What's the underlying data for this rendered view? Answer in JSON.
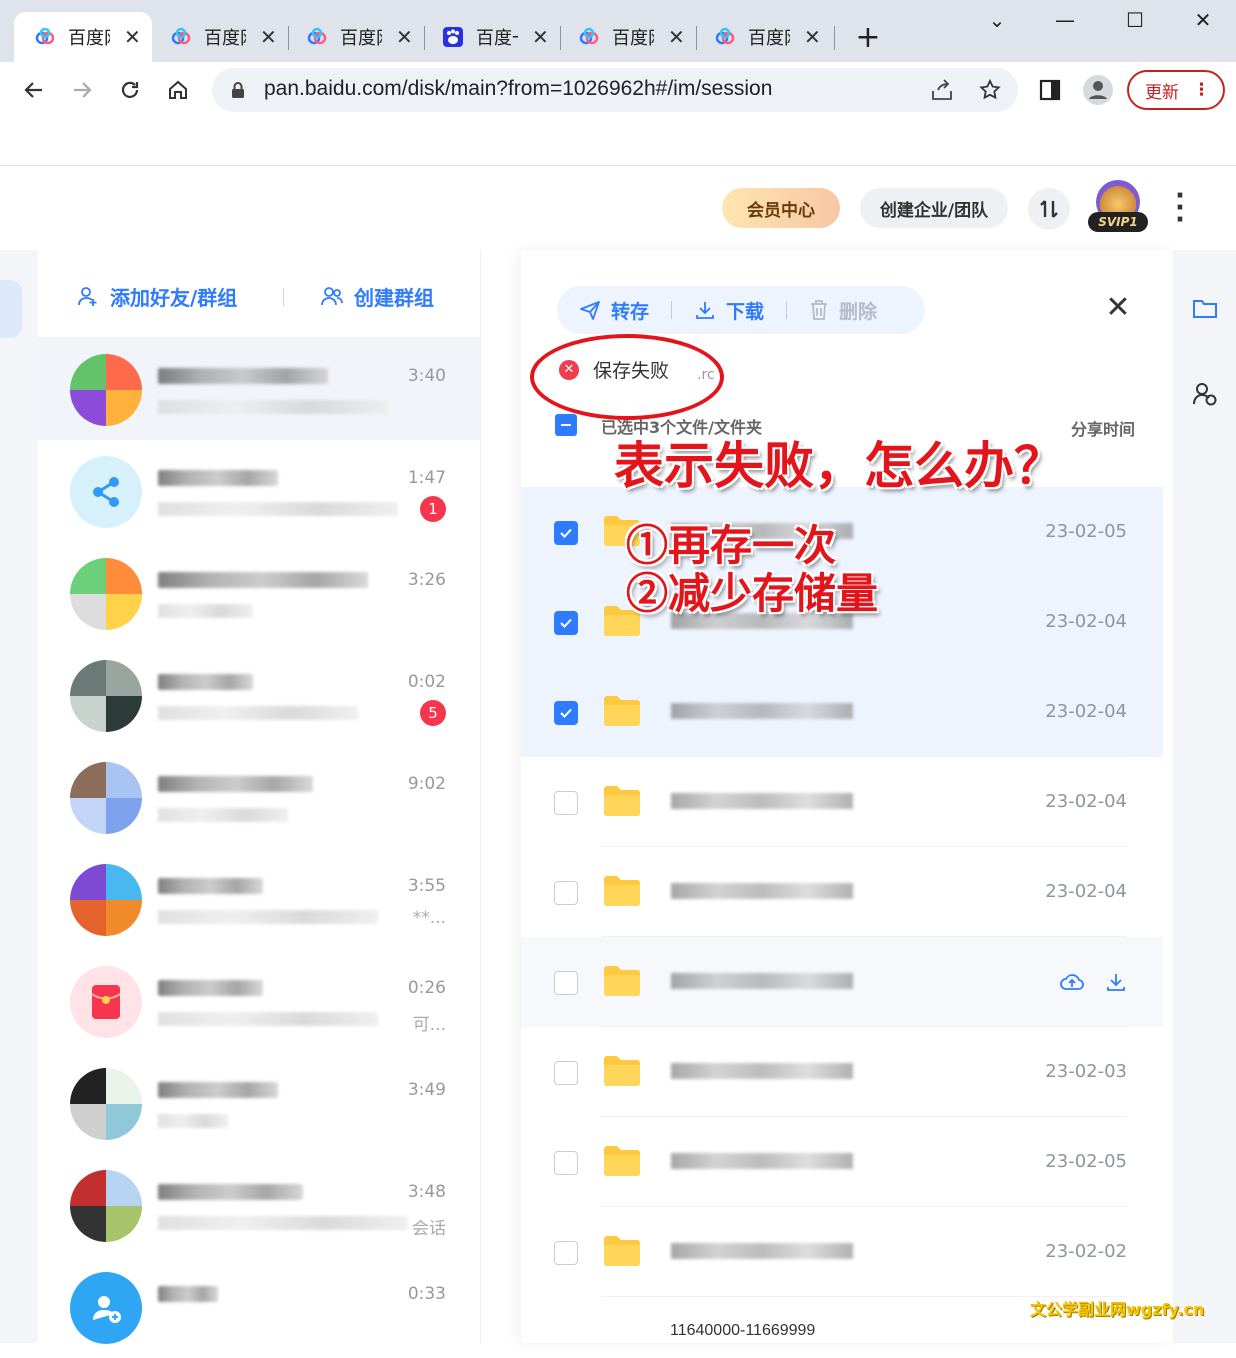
{
  "browser": {
    "tabs": [
      {
        "title": "百度网盘",
        "active": true
      },
      {
        "title": "百度网盘",
        "active": false
      },
      {
        "title": "百度网盘",
        "active": false
      },
      {
        "title": "百度一下",
        "active": false
      },
      {
        "title": "百度网盘",
        "active": false
      },
      {
        "title": "百度网盘",
        "active": false
      }
    ],
    "url": "pan.baidu.com/disk/main?from=1026962h#/im/session",
    "update_label": "更新",
    "new_tab": "+",
    "window_controls": {
      "minimize": "—",
      "maximize": "☐",
      "close": "✕",
      "tab_search": "⌄"
    }
  },
  "header": {
    "vip_center": "会员中心",
    "enterprise": "创建企业/团队",
    "transfer_icon": "transfer-icon",
    "svip_badge": "SVIP1"
  },
  "sidebar": {
    "add_friend": "添加好友/群组",
    "create_group": "创建群组",
    "chats": [
      {
        "time": "3:40",
        "snippet": "",
        "badge": ""
      },
      {
        "time": "1:47",
        "snippet": "",
        "badge": "1"
      },
      {
        "time": "3:26",
        "snippet": "",
        "badge": ""
      },
      {
        "time": "0:02",
        "snippet": "",
        "badge": "5"
      },
      {
        "time": "9:02",
        "snippet": "",
        "badge": ""
      },
      {
        "time": "3:55",
        "snippet": "**...",
        "badge": ""
      },
      {
        "time": "0:26",
        "snippet": "可...",
        "badge": ""
      },
      {
        "time": "3:49",
        "snippet": "",
        "badge": ""
      },
      {
        "time": "3:48",
        "snippet": "会话",
        "badge": ""
      },
      {
        "time": "0:33",
        "snippet": "",
        "badge": ""
      }
    ]
  },
  "panel": {
    "actions": {
      "save": "转存",
      "download": "下载",
      "delete": "删除"
    },
    "toast": {
      "message": "保存失败",
      "extra": ".rc"
    },
    "list_header": {
      "selected": "已选中3个文件/文件夹",
      "share_time": "分享时间"
    },
    "rows": [
      {
        "date": "23-02-05",
        "selected": true,
        "hover": false
      },
      {
        "date": "23-02-04",
        "selected": true,
        "hover": false
      },
      {
        "date": "23-02-04",
        "selected": true,
        "hover": false
      },
      {
        "date": "23-02-04",
        "selected": false,
        "hover": false
      },
      {
        "date": "23-02-04",
        "selected": false,
        "hover": false
      },
      {
        "date": "",
        "selected": false,
        "hover": true
      },
      {
        "date": "23-02-03",
        "selected": false,
        "hover": false
      },
      {
        "date": "23-02-05",
        "selected": false,
        "hover": false
      },
      {
        "date": "23-02-02",
        "selected": false,
        "hover": false
      }
    ],
    "partial_row_name": "11640000-11669999"
  },
  "annotation": {
    "question": "表示失败，怎么办？",
    "step1": "①再存一次",
    "step2": "②减少存储量"
  },
  "watermark": "文公学副业网wgzfy.cn",
  "colors": {
    "accent": "#2f7bff",
    "danger": "#e4141b",
    "badge": "#f5364e"
  }
}
